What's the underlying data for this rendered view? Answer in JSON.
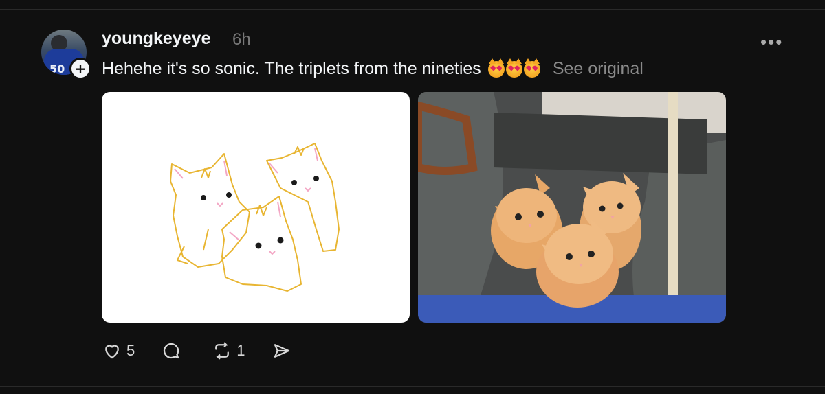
{
  "post": {
    "username": "youngkeyeye",
    "time": "6h",
    "text": "Hehehe it's so sonic. The triplets from the nineties",
    "emoji_name": "heart-eyes-cat-emoji",
    "see_original": "See original",
    "avatar_number": "50",
    "follow_symbol": "+",
    "more_symbol": "•••"
  },
  "images": [
    {
      "name": "kittens-drawing",
      "kind": "drawing"
    },
    {
      "name": "kittens-photo",
      "kind": "photo"
    }
  ],
  "actions": {
    "likes": "5",
    "replies": "",
    "reposts": "1",
    "shares": ""
  },
  "colors": {
    "background": "#101010",
    "text": "#f3f5f7",
    "muted": "#777777",
    "drawing_line": "#e8b531"
  }
}
